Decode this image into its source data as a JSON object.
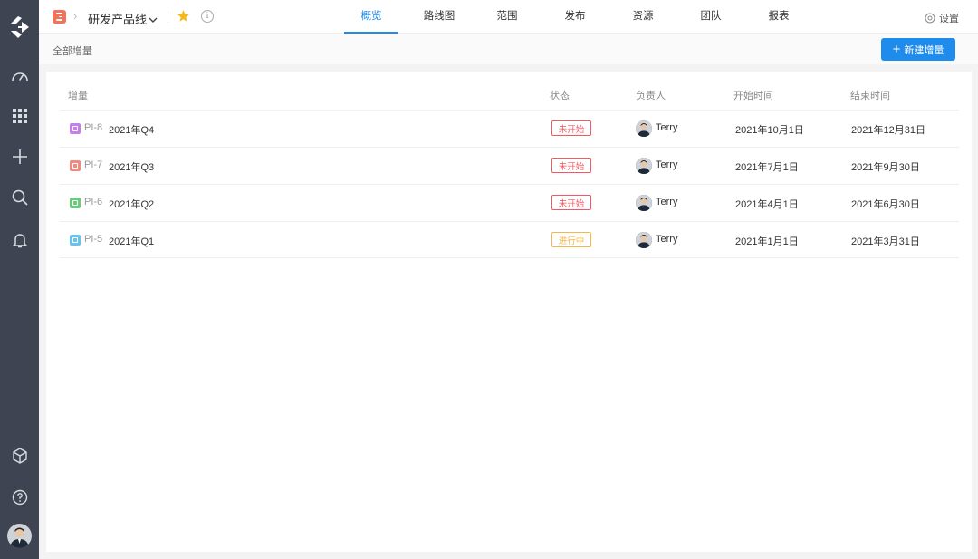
{
  "header": {
    "project_name": "研发产品线",
    "tabs": [
      {
        "label": "概览",
        "active": true
      },
      {
        "label": "路线图"
      },
      {
        "label": "范围"
      },
      {
        "label": "发布"
      },
      {
        "label": "资源"
      },
      {
        "label": "团队"
      },
      {
        "label": "报表"
      }
    ],
    "settings_label": "设置"
  },
  "subheader": {
    "title": "全部增量",
    "new_button_label": "新建增量"
  },
  "table": {
    "columns": {
      "increment": "增量",
      "status": "状态",
      "owner": "负责人",
      "start": "开始时间",
      "end": "结束时间"
    },
    "rows": [
      {
        "code": "PI-8",
        "title": "2021年Q4",
        "status": "未开始",
        "status_color": "#f5575f",
        "owner": "Terry",
        "start": "2021年10月1日",
        "end": "2021年12月31日",
        "icon_color": "#c77ee8"
      },
      {
        "code": "PI-7",
        "title": "2021年Q3",
        "status": "未开始",
        "status_color": "#f5575f",
        "owner": "Terry",
        "start": "2021年7月1日",
        "end": "2021年9月30日",
        "icon_color": "#f08a80"
      },
      {
        "code": "PI-6",
        "title": "2021年Q2",
        "status": "未开始",
        "status_color": "#f5575f",
        "owner": "Terry",
        "start": "2021年4月1日",
        "end": "2021年6月30日",
        "icon_color": "#6cc87f"
      },
      {
        "code": "PI-5",
        "title": "2021年Q1",
        "status": "进行中",
        "status_color": "#f7b843",
        "owner": "Terry",
        "start": "2021年1月1日",
        "end": "2021年3月31日",
        "icon_color": "#66c3ee"
      }
    ]
  },
  "colors": {
    "accent": "#1f8ceb",
    "rail": "#3e4451",
    "star": "#f5b81e"
  }
}
